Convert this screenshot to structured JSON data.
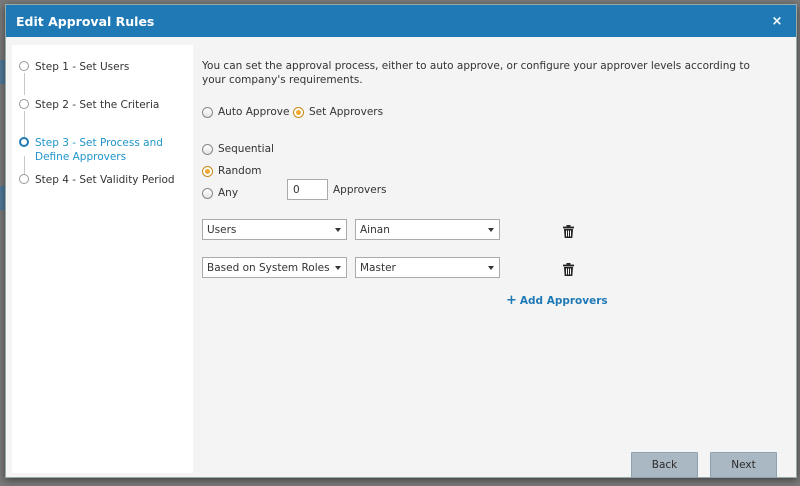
{
  "modal": {
    "title": "Edit Approval Rules",
    "close_label": "×"
  },
  "steps": [
    {
      "label": "Step 1 - Set Users",
      "active": false
    },
    {
      "label": "Step 2 - Set the Criteria",
      "active": false
    },
    {
      "label": "Step 3 - Set Process and Define Approvers",
      "active": true
    },
    {
      "label": "Step 4 - Set Validity Period",
      "active": false
    }
  ],
  "intro_text": "You can set the approval process, either to auto approve, or configure your approver levels according to your company's requirements.",
  "approval_mode": {
    "options": [
      "Auto Approve",
      "Set Approvers"
    ],
    "selected": "Set Approvers"
  },
  "process_type": {
    "options": [
      "Sequential",
      "Random",
      "Any"
    ],
    "selected": "Random"
  },
  "any_count": {
    "value": "0",
    "suffix": "Approvers"
  },
  "approver_rows": [
    {
      "type": "Users",
      "value": "Ainan"
    },
    {
      "type": "Based on System Roles",
      "value": "Master"
    }
  ],
  "add_approvers_label": "Add Approvers",
  "footer": {
    "back_label": "Back",
    "next_label": "Next"
  },
  "colors": {
    "header_bg": "#1f79b5",
    "active_step": "#1f94c9",
    "radio_checked": "#f0a830",
    "button_bg": "#aab8c4"
  },
  "icons": {
    "close": "close-icon",
    "delete": "trash-icon",
    "add": "plus-icon",
    "dropdown": "caret-down-icon"
  }
}
